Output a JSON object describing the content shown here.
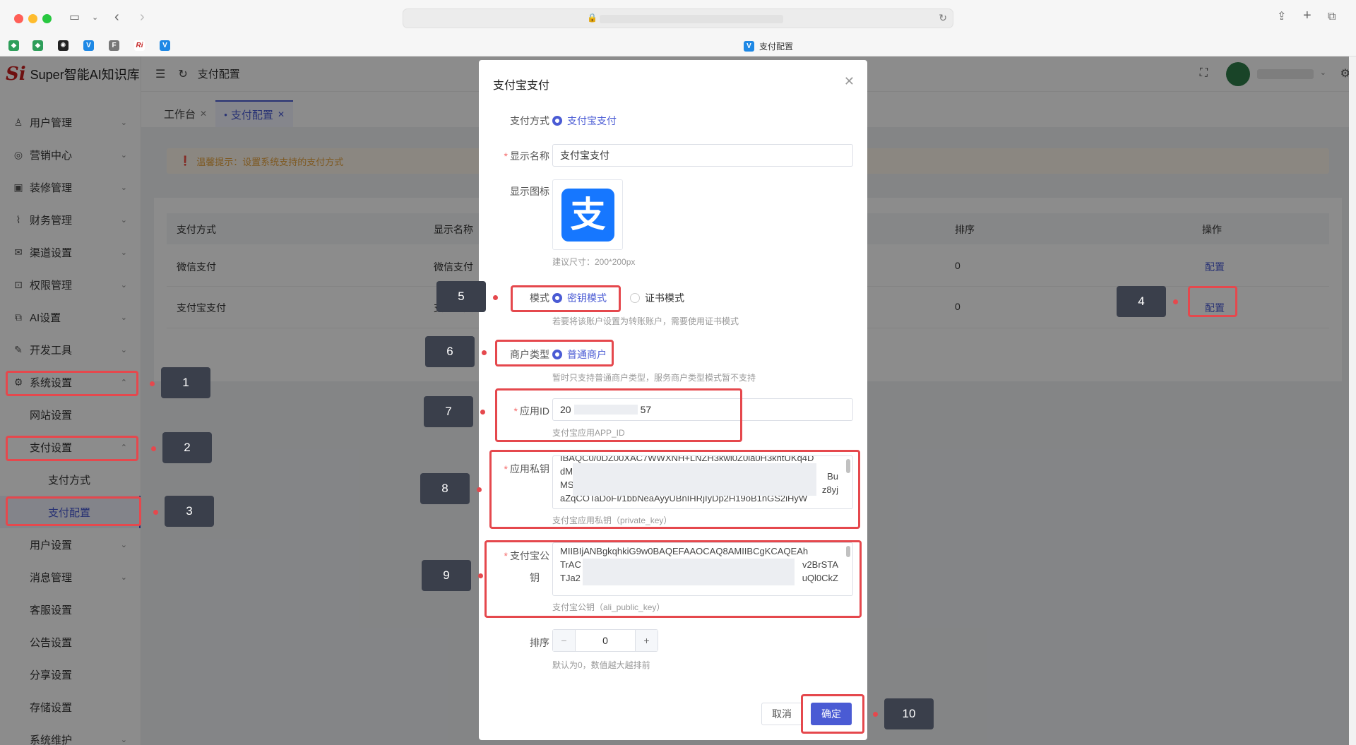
{
  "browser": {
    "tab_title": "支付配置",
    "favicons": [
      "shield",
      "shield",
      "openai",
      "vue",
      "F",
      "Ri",
      "vue"
    ]
  },
  "sidebar": {
    "app_name": "Super智能AI知识库",
    "logo_text": "Si",
    "items": [
      {
        "label": "用户管理",
        "icon": "user-icon"
      },
      {
        "label": "营销中心",
        "icon": "target-icon"
      },
      {
        "label": "装修管理",
        "icon": "decoration-icon"
      },
      {
        "label": "财务管理",
        "icon": "chart-icon"
      },
      {
        "label": "渠道设置",
        "icon": "mail-icon"
      },
      {
        "label": "权限管理",
        "icon": "lock-icon"
      },
      {
        "label": "AI设置",
        "icon": "copy-icon"
      },
      {
        "label": "开发工具",
        "icon": "pen-icon"
      },
      {
        "label": "系统设置",
        "icon": "gear-icon"
      },
      {
        "label": "网站设置"
      },
      {
        "label": "支付设置"
      },
      {
        "label": "支付方式"
      },
      {
        "label": "支付配置"
      },
      {
        "label": "用户设置"
      },
      {
        "label": "消息管理"
      },
      {
        "label": "客服设置"
      },
      {
        "label": "公告设置"
      },
      {
        "label": "分享设置"
      },
      {
        "label": "存储设置"
      },
      {
        "label": "系统维护"
      }
    ]
  },
  "topbar": {
    "breadcrumb": "支付配置"
  },
  "tabs": [
    {
      "label": "工作台"
    },
    {
      "label": "支付配置"
    }
  ],
  "tip": "温馨提示：设置系统支持的支付方式",
  "table": {
    "headers": [
      "支付方式",
      "显示名称",
      "排序",
      "操作"
    ],
    "rows": [
      {
        "method": "微信支付",
        "name": "微信支付",
        "sort": "0",
        "action": "配置"
      },
      {
        "method": "支付宝支付",
        "name": "支付宝支付",
        "sort": "0",
        "action": "配置"
      }
    ]
  },
  "modal": {
    "title": "支付宝支付",
    "pay_method_label": "支付方式",
    "pay_method_value": "支付宝支付",
    "display_name_label": "显示名称",
    "display_name_value": "支付宝支付",
    "display_icon_label": "显示图标",
    "icon_glyph": "支",
    "icon_hint": "建议尺寸：200*200px",
    "mode_label": "模式",
    "mode_options": [
      "密钥模式",
      "证书模式"
    ],
    "mode_hint": "若要将该账户设置为转账账户，需要使用证书模式",
    "merchant_label": "商户类型",
    "merchant_option": "普通商户",
    "merchant_hint": "暂时只支持普通商户类型，服务商户类型模式暂不支持",
    "appid_label": "应用ID",
    "appid_prefix": "20",
    "appid_suffix": "57",
    "appid_hint": "支付宝应用APP_ID",
    "private_key_label": "应用私钥",
    "private_key_lines": [
      "IBAQC0/0DZ00XAC7WWXNH+LNZH3kwl0Z0ia0H3khtUKq4D",
      "dM",
      "MS",
      "aZqCOTaDoFI/1bbNeaAyyUBnIHRjIyDp2H19oB1nGS2iHyW"
    ],
    "private_key_right": [
      "Bu",
      "z8yj"
    ],
    "private_key_hint": "支付宝应用私钥（private_key）",
    "public_key_label_1": "支付宝公",
    "public_key_label_2": "钥",
    "public_key_lines": [
      "MIIBIjANBgkqhkiG9w0BAQEFAAOCAQ8AMIIBCgKCAQEAh",
      "TrAC",
      "TJa2"
    ],
    "public_key_right": [
      "v2BrSTA",
      "uQl0CkZ"
    ],
    "public_key_hint": "支付宝公钥（ali_public_key）",
    "sort_label": "排序",
    "sort_value": "0",
    "sort_hint": "默认为0，数值越大越排前",
    "cancel": "取消",
    "confirm": "确定"
  },
  "badges": [
    "1",
    "2",
    "3",
    "4",
    "5",
    "6",
    "7",
    "8",
    "9",
    "10"
  ],
  "colors": {
    "accent": "#4a5bd4",
    "highlight": "#e5484d",
    "badge": "#3a3f4b"
  }
}
